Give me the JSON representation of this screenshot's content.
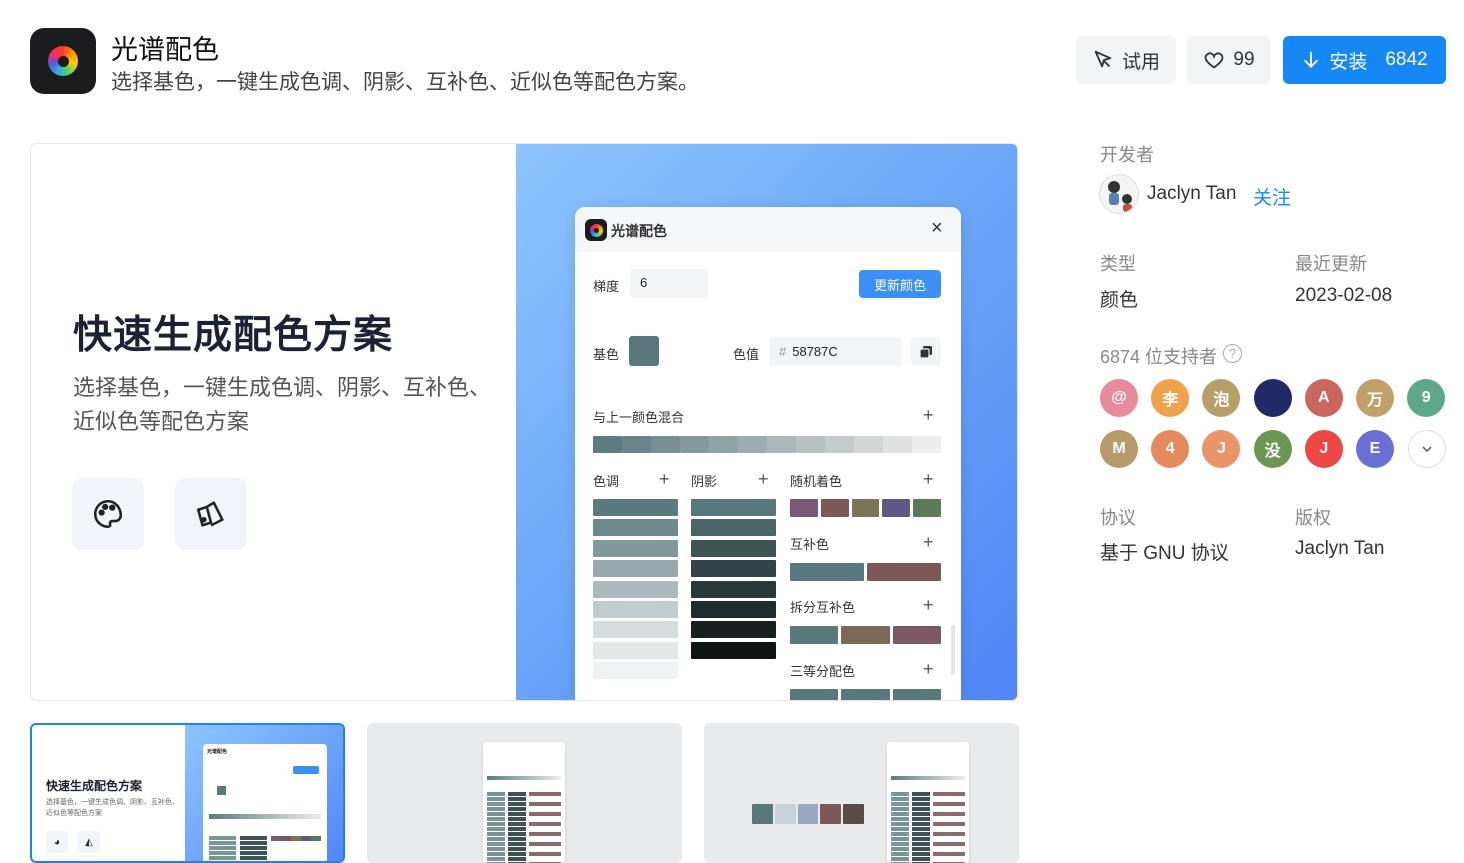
{
  "app": {
    "name": "光谱配色",
    "description": "选择基色，一键生成色调、阴影、互补色、近似色等配色方案。"
  },
  "actions": {
    "try_label": "试用",
    "like_count": "99",
    "install_label": "安装",
    "install_count": "6842"
  },
  "hero": {
    "title": "快速生成配色方案",
    "subtitle": "选择基色，一键生成色调、阴影、互补色、近似色等配色方案",
    "feature_icons": [
      "palette-icon",
      "swatch-book-icon"
    ]
  },
  "plugin": {
    "title": "光谱配色",
    "steps_label": "梯度",
    "steps_value": "6",
    "update_label": "更新颜色",
    "base_label": "基色",
    "value_label": "色值",
    "hash": "#",
    "hex_value": "58787C",
    "mix_label": "与上一颜色混合",
    "tone_label": "色调",
    "shade_label": "阴影",
    "random_label": "随机着色",
    "complement_label": "互补色",
    "split_label": "拆分互补色",
    "triad_label": "三等分配色",
    "base_color": "#58787c",
    "mix_colors": [
      "#5e7b7f",
      "#6a8589",
      "#778f92",
      "#84999c",
      "#91a3a5",
      "#9eadaf",
      "#abb7b8",
      "#b8c1c2",
      "#c5cbcc",
      "#d2d6d6",
      "#dfe1e1",
      "#ecedee"
    ],
    "tint_colors": [
      "#5b7a7e",
      "#6d898d",
      "#81999c",
      "#96aaac",
      "#abbbbd",
      "#c0cccd",
      "#d4dddd",
      "#e2e8e8",
      "#eef2f2"
    ],
    "shade_colors": [
      "#58787c",
      "#4a6568",
      "#3d5356",
      "#324446",
      "#283738",
      "#1f2b2c",
      "#171f20",
      "#0e1313"
    ],
    "random_colors": [
      "#7a5a72",
      "#7c5858",
      "#7a7658",
      "#5e5884",
      "#5c7a58"
    ],
    "complement_colors": [
      "#58787c",
      "#7c5858"
    ],
    "split_colors": [
      "#58787c",
      "#7c6a58",
      "#7c5865"
    ],
    "triad_colors": [
      "#58787c",
      "#58787c",
      "#58787c"
    ]
  },
  "developer": {
    "label": "开发者",
    "name": "Jaclyn Tan",
    "follow": "关注"
  },
  "meta": {
    "type_label": "类型",
    "type_value": "颜色",
    "updated_label": "最近更新",
    "updated_value": "2023-02-08",
    "supporters_label": "6874 位支持者",
    "license_label": "协议",
    "license_value": "基于 GNU 协议",
    "copyright_label": "版权",
    "copyright_value": "Jaclyn Tan"
  },
  "supporters": [
    {
      "initial": "@",
      "color": "#e88a9a"
    },
    {
      "initial": "李",
      "color": "#f0a24a"
    },
    {
      "initial": "泡",
      "color": "#b79f6a"
    },
    {
      "initial": "",
      "color": "#1f2a66"
    },
    {
      "initial": "A",
      "color": "#c9675d"
    },
    {
      "initial": "万",
      "color": "#c2a06a"
    },
    {
      "initial": "9",
      "color": "#5da888"
    },
    {
      "initial": "M",
      "color": "#b59a6a"
    },
    {
      "initial": "4",
      "color": "#e58a5c"
    },
    {
      "initial": "J",
      "color": "#e8956a"
    },
    {
      "initial": "没",
      "color": "#6c9654"
    },
    {
      "initial": "J",
      "color": "#ee4545"
    },
    {
      "initial": "E",
      "color": "#6b6fd4"
    }
  ],
  "thumb2_colors": [
    "#58787c",
    "#c7d3d6",
    "#9aa7c2",
    "#7c5858",
    "#5a4a48"
  ]
}
